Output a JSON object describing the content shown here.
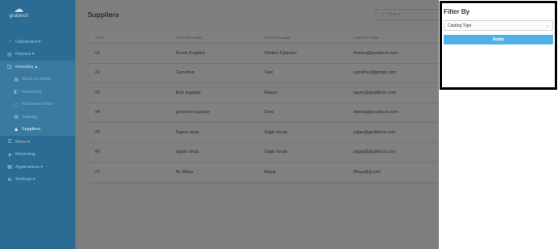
{
  "brand": {
    "name": "grubtech",
    "logo_icon": "chef-hat-icon"
  },
  "sidebar": {
    "items": [
      {
        "label": "Dashboard ▾",
        "icon": "dashboard-icon",
        "glyph": "◔"
      },
      {
        "label": "Reports ▾",
        "icon": "reports-icon",
        "glyph": "▤"
      },
      {
        "label": "Inventory ▴",
        "icon": "inventory-icon",
        "glyph": "◫"
      }
    ],
    "sub_items": [
      {
        "label": "Stock on hand",
        "icon": "stock-icon",
        "glyph": "▣"
      },
      {
        "label": "Receiving",
        "icon": "receiving-icon",
        "glyph": "◧"
      },
      {
        "label": "Purchase Order",
        "icon": "purchase-order-icon",
        "glyph": "▢"
      },
      {
        "label": "Catalog",
        "icon": "catalog-icon",
        "glyph": "▦"
      },
      {
        "label": "Suppliers",
        "icon": "user-icon",
        "glyph": "♟"
      }
    ],
    "bottom_items": [
      {
        "label": "Menu ▾",
        "icon": "menu-icon",
        "glyph": "☰"
      },
      {
        "label": "Marketing",
        "icon": "marketing-icon",
        "glyph": "◈"
      },
      {
        "label": "Applications ▾",
        "icon": "applications-icon",
        "glyph": "▦"
      },
      {
        "label": "Settings ▾",
        "icon": "settings-icon",
        "glyph": "⚙"
      }
    ]
  },
  "main": {
    "title": "Suppliers",
    "search": {
      "placeholder": "Search",
      "icon": "search-icon"
    },
    "table": {
      "headers": [
        "CODE",
        "SUPPLIER NAME",
        "CONTACT NAME",
        "CONTACT EMAIL"
      ],
      "rows": [
        [
          "#1",
          "Greek Supplier",
          "Dimitra Fylantzo",
          "dimitra@grubtech.com"
        ],
        [
          "#2",
          "Carrefour",
          "Test",
          "carrefour@gmail.com"
        ],
        [
          "#3",
          "Fish supplier",
          "Razan",
          "razan@grubtech.com"
        ],
        [
          "#4",
          "grubtech supplier",
          "Dimi",
          "dimitra@grubtech.com"
        ],
        [
          "#5",
          "Sajars shop",
          "Sajar Imran",
          "sajjar@grubtech.com"
        ],
        [
          "#6",
          "sajars shop",
          "Sajar Imran",
          "sajjar@grubtech.com"
        ],
        [
          "#7",
          "AL Maya",
          "Maya",
          "Maya@g.com"
        ]
      ]
    }
  },
  "filter": {
    "title": "Filter By",
    "select_value": "Catalog Type",
    "apply_label": "Apply"
  },
  "colors": {
    "sidebar": "#2c6b93",
    "overlay": "#7e7e7e",
    "apply": "#4fb0e8"
  }
}
